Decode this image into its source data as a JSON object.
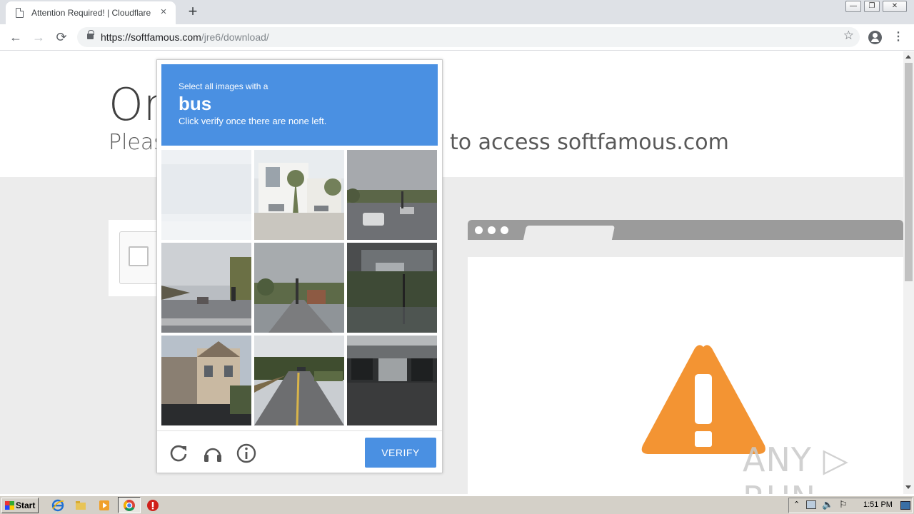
{
  "browser": {
    "tab_title": "Attention Required! | Cloudflare",
    "tab_close": "×",
    "new_tab": "+",
    "url_host": "https://softfamous.com",
    "url_path": "/jre6/download/",
    "back": "←",
    "forward": "→",
    "reload": "⟳",
    "bookmark_star": "☆",
    "menu": "⋮"
  },
  "window_controls": {
    "minimize": "—",
    "restore": "❐",
    "close": "✕"
  },
  "page": {
    "title_fragment": "On",
    "subtitle_left": "Pleas",
    "subtitle_right": "to access softfamous.com"
  },
  "captcha": {
    "instruction": "Select all images with a",
    "keyword": "bus",
    "hint": "Click verify once there are none left.",
    "verify_label": "VERIFY",
    "icons": [
      "reload-icon",
      "audio-icon",
      "info-icon"
    ]
  },
  "watermark": "ANY ▷ RUN",
  "taskbar": {
    "start_label": "Start",
    "clock": "1:51 PM",
    "quick_launch": [
      "ie-icon",
      "folder-icon",
      "media-player-icon",
      "chrome-icon",
      "stop-icon"
    ]
  },
  "colors": {
    "captcha_blue": "#4a90e2",
    "warning_orange": "#f39433",
    "page_gray": "#ececec"
  }
}
